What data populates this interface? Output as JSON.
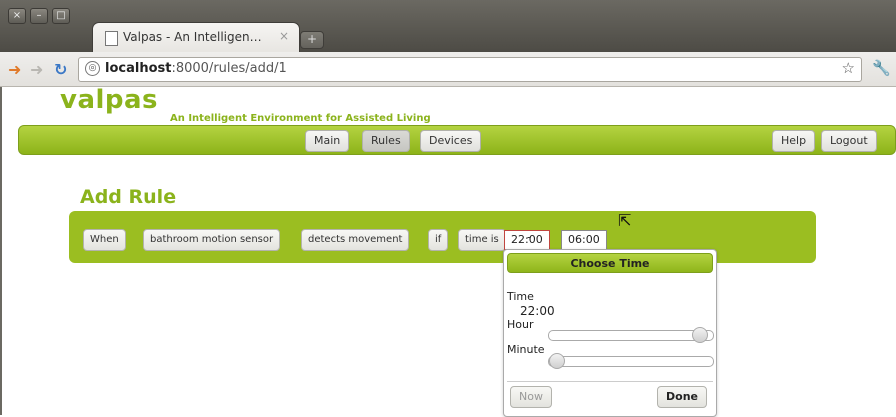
{
  "browser": {
    "window_buttons": [
      "×",
      "–",
      "□"
    ],
    "tab_title": "Valpas - An Intelligen…",
    "tab_close": "×",
    "new_tab": "+",
    "url_host": "localhost",
    "url_path": ":8000/rules/add/1"
  },
  "site": {
    "logo": "valpas",
    "tagline": "An Intelligent Environment for Assisted Living",
    "nav": [
      {
        "label": "Main",
        "active": false
      },
      {
        "label": "Rules",
        "active": true
      },
      {
        "label": "Devices",
        "active": false
      }
    ],
    "nav_right": [
      {
        "label": "Help"
      },
      {
        "label": "Logout"
      }
    ]
  },
  "page": {
    "heading": "Add Rule"
  },
  "rule": {
    "when": "When",
    "device": "bathroom motion sensor",
    "event": "detects movement",
    "if": "if",
    "condition": "time is",
    "time_from": "22:00",
    "separator": "-",
    "time_to": "06:00"
  },
  "time_picker": {
    "title": "Choose Time",
    "time_label": "Time",
    "time_value": "22:00",
    "hour_label": "Hour",
    "hour_value": 22,
    "minute_label": "Minute",
    "minute_value": 0,
    "now_button": "Now",
    "done_button": "Done"
  },
  "colors": {
    "brand_green": "#8bb31c",
    "focus_red": "#c0463f"
  }
}
